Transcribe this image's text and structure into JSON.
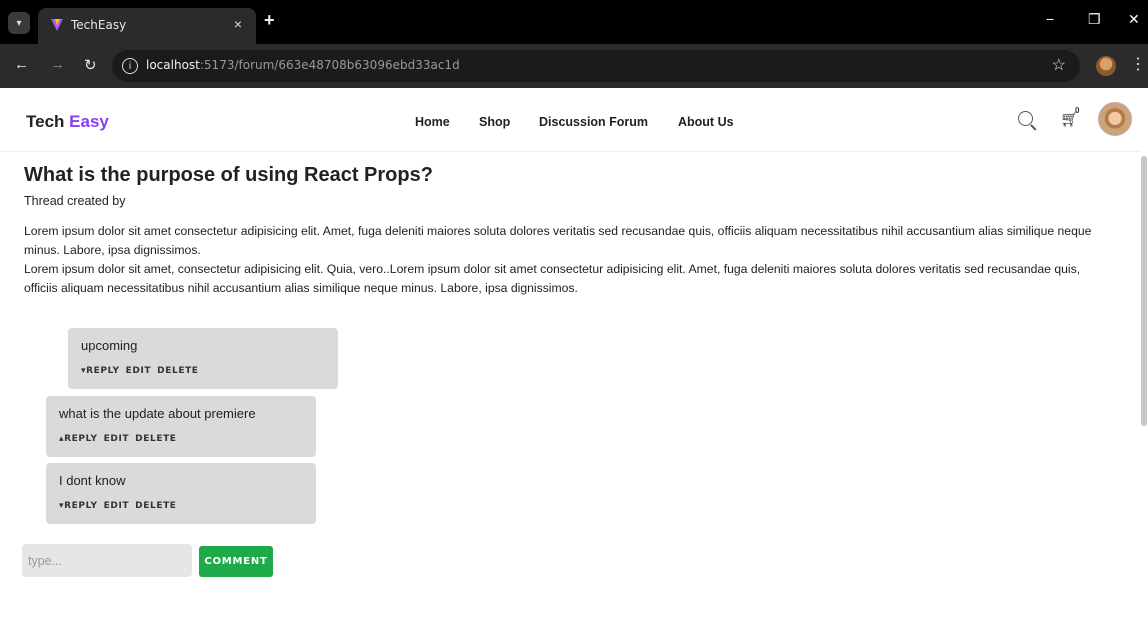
{
  "browser": {
    "tab_title": "TechEasy",
    "tab_close": "×",
    "new_tab": "+",
    "url_host": "localhost",
    "url_path": ":5173/forum/663e48708b63096ebd33ac1d",
    "minimize": "−",
    "restore": "❐",
    "close": "✕"
  },
  "site": {
    "brand_first": "Tech",
    "brand_second": "Easy",
    "accent_color": "#8b3df0",
    "nav": [
      "Home",
      "Shop",
      "Discussion Forum",
      "About Us"
    ],
    "cart_count": "0"
  },
  "thread": {
    "title": "What is the purpose of using React Props?",
    "created_by": "Thread created by",
    "body_1": "Lorem ipsum dolor sit amet consectetur adipisicing elit. Amet, fuga deleniti maiores soluta dolores veritatis sed recusandae quis, officiis aliquam necessitatibus nihil accusantium alias similique neque minus. Labore, ipsa dignissimos.",
    "body_2": "Lorem ipsum dolor sit amet, consectetur adipisicing elit. Quia, vero..Lorem ipsum dolor sit amet consectetur adipisicing elit. Amet, fuga deleniti maiores soluta dolores veritatis sed recusandae quis, officiis aliquam necessitatibus nihil accusantium alias similique neque minus. Labore, ipsa dignissimos."
  },
  "comments": [
    {
      "text": "upcoming",
      "reply_label": "▾REPLY",
      "edit_label": "EDIT",
      "delete_label": "DELETE"
    },
    {
      "text": "what is the update about premiere",
      "reply_label": "▴REPLY",
      "edit_label": "EDIT",
      "delete_label": "DELETE"
    },
    {
      "text": "I dont know",
      "reply_label": "▾REPLY",
      "edit_label": "EDIT",
      "delete_label": "DELETE"
    }
  ],
  "comment_form": {
    "placeholder": "type...",
    "button_label": "COMMENT",
    "button_color": "#1faa4a"
  }
}
